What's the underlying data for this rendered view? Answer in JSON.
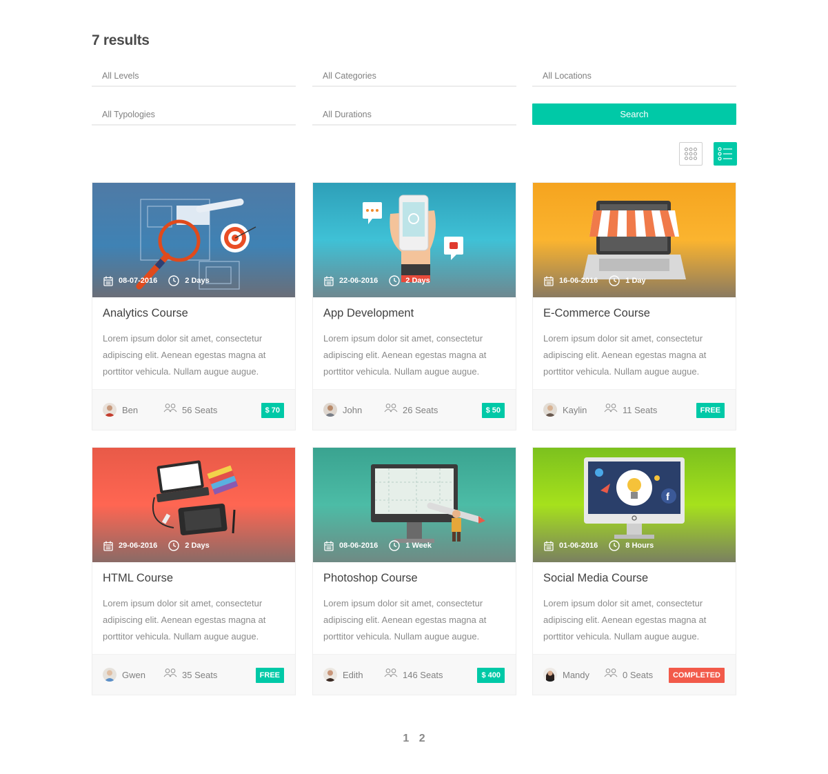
{
  "results_title": "7 results",
  "filters": {
    "levels": "All Levels",
    "categories": "All Categories",
    "locations": "All Locations",
    "typologies": "All Typologies",
    "durations": "All Durations"
  },
  "search_label": "Search",
  "view": {
    "active": "list",
    "accent": "#00c9a7"
  },
  "courses": [
    {
      "title": "Analytics Course",
      "date": "08-07-2016",
      "duration": "2 Days",
      "description": "Lorem ipsum dolor sit amet, consectetur adipiscing elit. Aenean egestas magna at porttitor vehicula. Nullam augue augue.",
      "teacher": "Ben",
      "seats": "56 Seats",
      "badge": "$ 70",
      "badge_color": "#00c9a7"
    },
    {
      "title": "App Development",
      "date": "22-06-2016",
      "duration": "2 Days",
      "description": "Lorem ipsum dolor sit amet, consectetur adipiscing elit. Aenean egestas magna at porttitor vehicula. Nullam augue augue.",
      "teacher": "John",
      "seats": "26 Seats",
      "badge": "$ 50",
      "badge_color": "#00c9a7"
    },
    {
      "title": "E-Commerce Course",
      "date": "16-06-2016",
      "duration": "1 Day",
      "description": "Lorem ipsum dolor sit amet, consectetur adipiscing elit. Aenean egestas magna at porttitor vehicula. Nullam augue augue.",
      "teacher": "Kaylin",
      "seats": "11 Seats",
      "badge": "FREE",
      "badge_color": "#00c9a7"
    },
    {
      "title": "HTML Course",
      "date": "29-06-2016",
      "duration": "2 Days",
      "description": "Lorem ipsum dolor sit amet, consectetur adipiscing elit. Aenean egestas magna at porttitor vehicula. Nullam augue augue.",
      "teacher": "Gwen",
      "seats": "35 Seats",
      "badge": "FREE",
      "badge_color": "#00c9a7"
    },
    {
      "title": "Photoshop Course",
      "date": "08-06-2016",
      "duration": "1 Week",
      "description": "Lorem ipsum dolor sit amet, consectetur adipiscing elit. Aenean egestas magna at porttitor vehicula. Nullam augue augue.",
      "teacher": "Edith",
      "seats": "146 Seats",
      "badge": "$ 400",
      "badge_color": "#00c9a7"
    },
    {
      "title": "Social Media Course",
      "date": "01-06-2016",
      "duration": "8 Hours",
      "description": "Lorem ipsum dolor sit amet, consectetur adipiscing elit. Aenean egestas magna at porttitor vehicula. Nullam augue augue.",
      "teacher": "Mandy",
      "seats": "0 Seats",
      "badge": "COMPLETED",
      "badge_color": "#f25a4a"
    }
  ],
  "pagination": {
    "pages": [
      "1",
      "2"
    ]
  }
}
